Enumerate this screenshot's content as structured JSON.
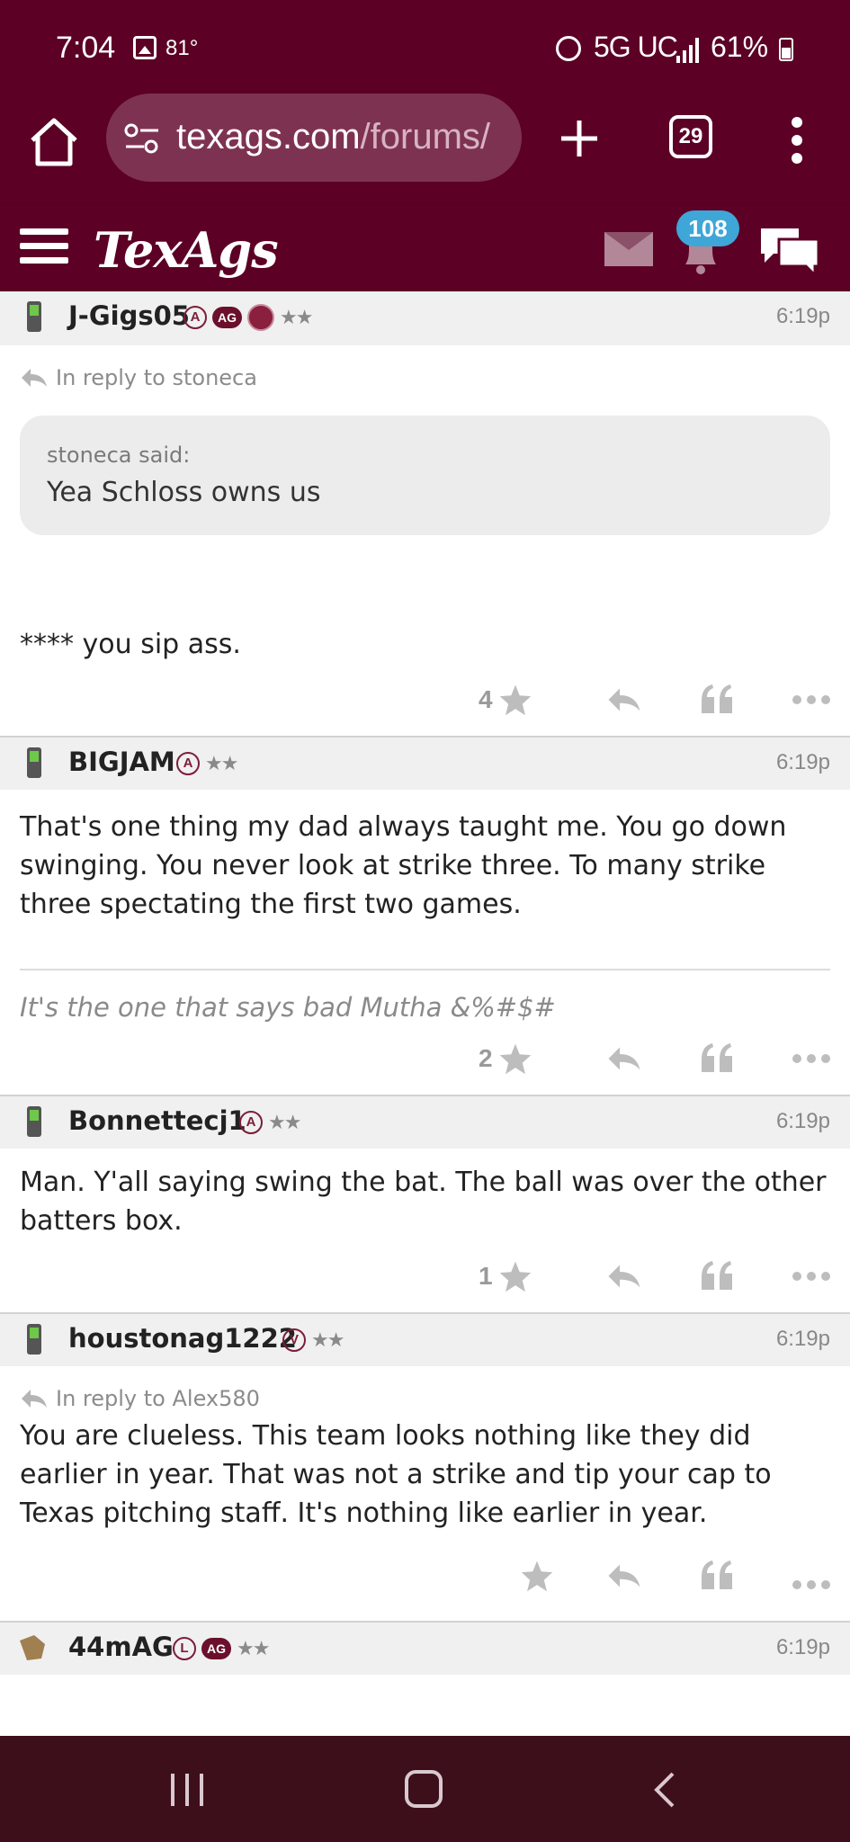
{
  "status_bar": {
    "time": "7:04",
    "temperature": "81°",
    "network": "5G UC",
    "battery": "61%"
  },
  "browser": {
    "url_main": "texags.com",
    "url_path": "/forums/",
    "tab_count": "29"
  },
  "site": {
    "logo": "TexAgs",
    "notification_count": "108"
  },
  "posts": [
    {
      "username": "J-Gigs05",
      "badges": [
        "A",
        "AG"
      ],
      "time": "6:19p",
      "reply_to": "In reply to stoneca",
      "quote_author": "stoneca said:",
      "quote_text": "Yea Schloss owns us",
      "text": "**** you sip ass.",
      "likes": "4"
    },
    {
      "username": "BIGJAM",
      "badges": [
        "A"
      ],
      "time": "6:19p",
      "text": "That's one thing my dad always taught me. You go down swinging. You never look at strike three. To many strike three spectating the first two games.",
      "signature": "It's the one that says bad Mutha &%#$#",
      "likes": "2"
    },
    {
      "username": "Bonnettecj1",
      "badges": [
        "A"
      ],
      "time": "6:19p",
      "text": "Man. Y'all saying swing the bat. The ball was over the other batters box.",
      "likes": "1"
    },
    {
      "username": "houstonag1222",
      "badges": [
        "V"
      ],
      "time": "6:19p",
      "reply_to": "In reply to Alex580",
      "text": "You are clueless. This team looks nothing like they did earlier in year. That was not a strike and tip your cap to Texas pitching staff. It's nothing like earlier in year.",
      "likes": ""
    },
    {
      "username": "44mAG",
      "badges": [
        "L",
        "AG"
      ],
      "time": "6:19p"
    }
  ],
  "colors": {
    "maroon": "#5c0025",
    "badge_blue": "#3fa6d8",
    "nav_bar": "#3d0f1b"
  }
}
